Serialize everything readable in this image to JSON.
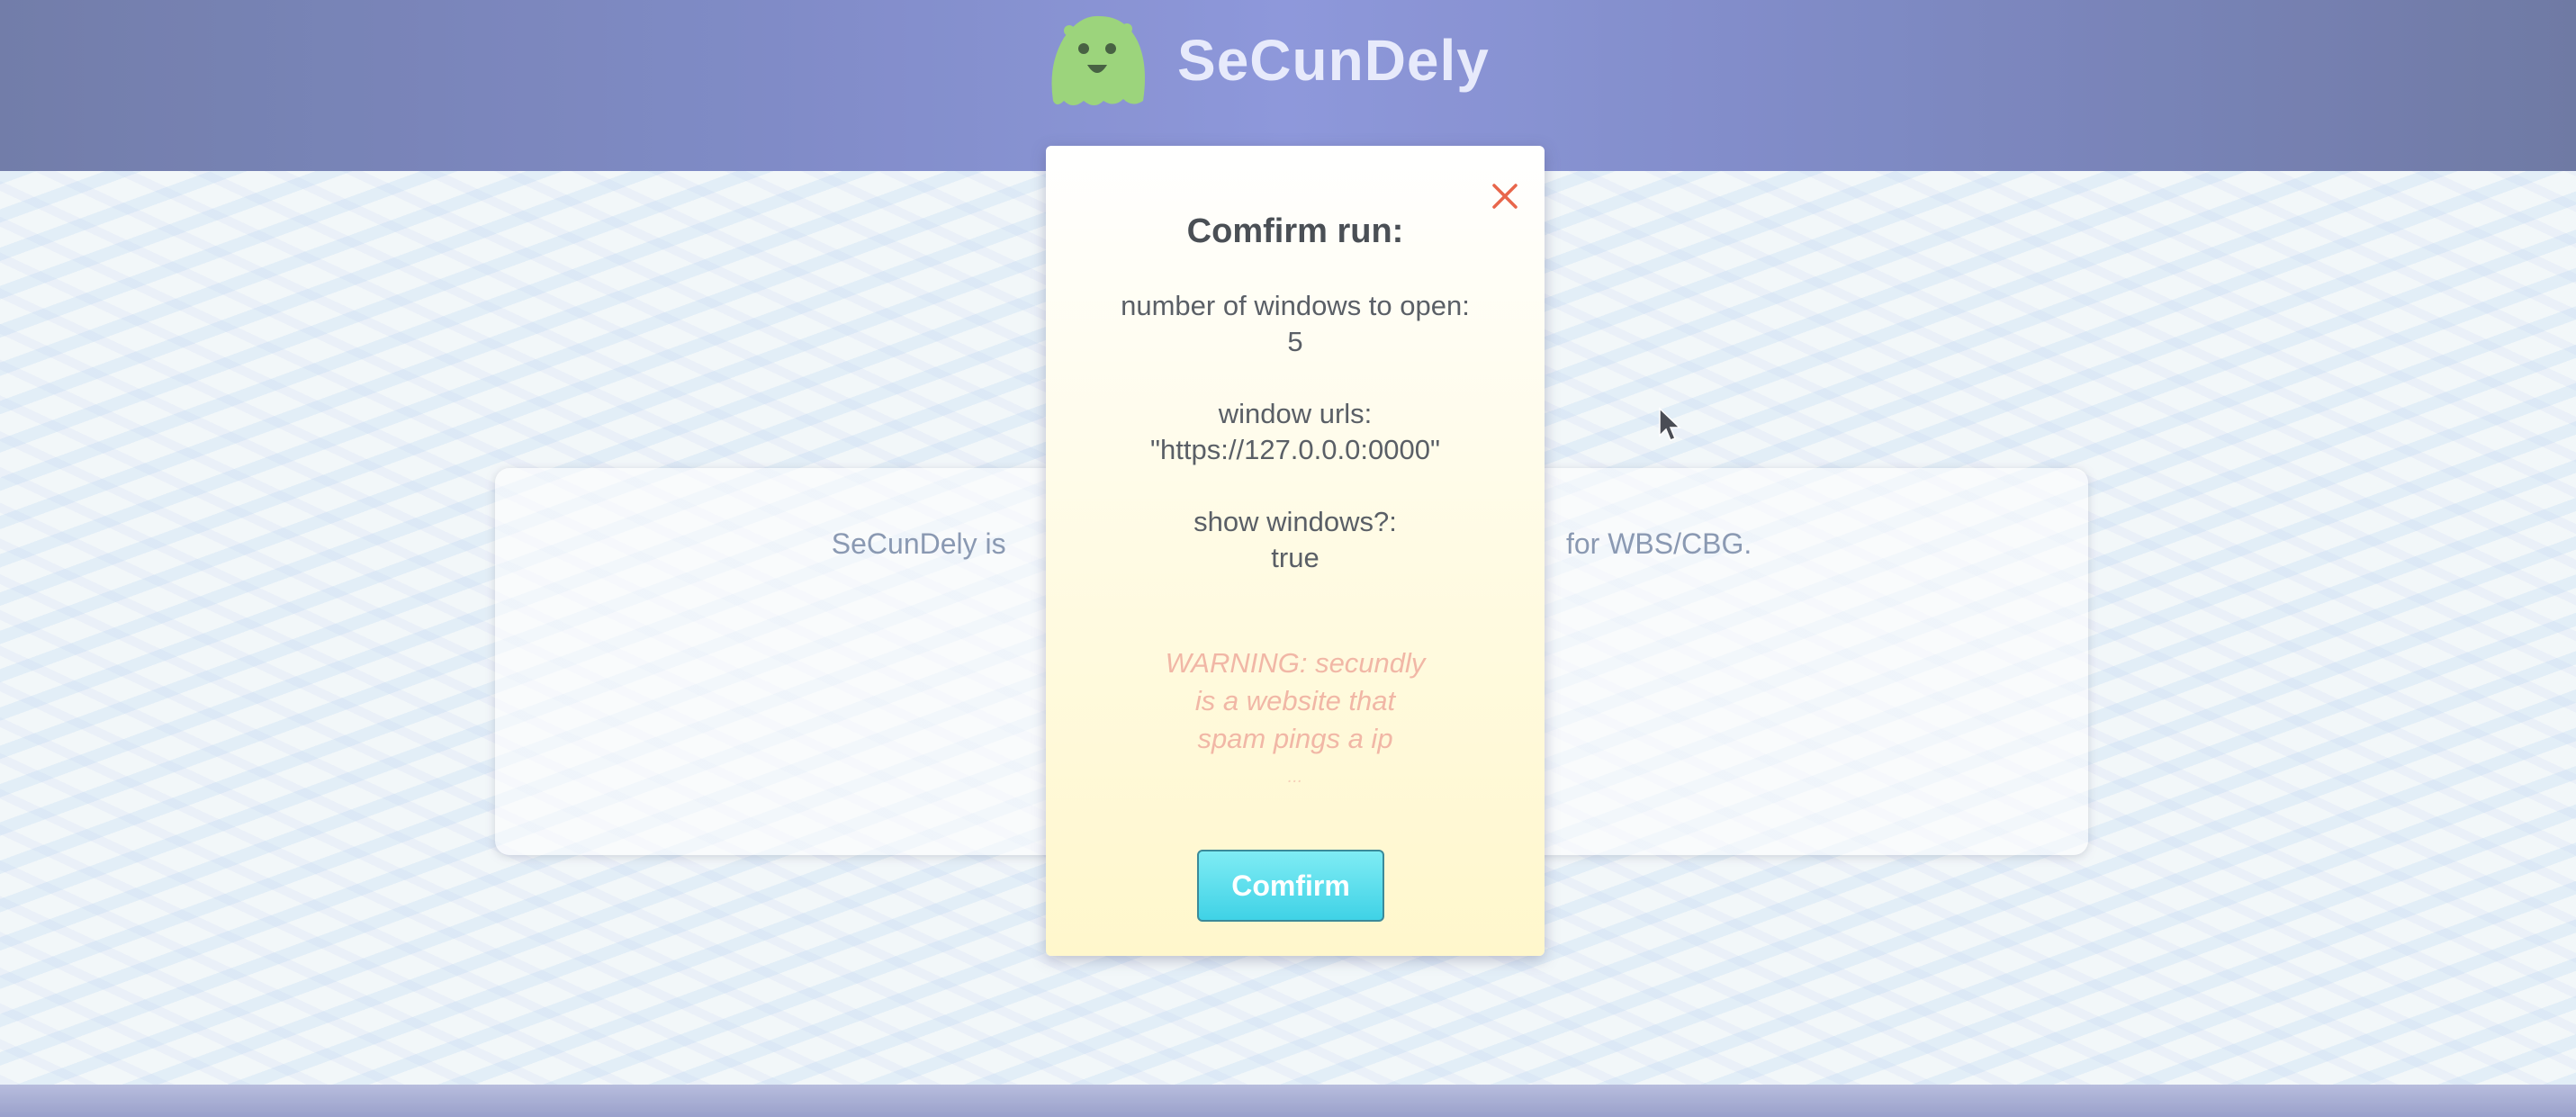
{
  "header": {
    "brand": "SeCunDely",
    "logo_icon": "ghost-mascot-icon"
  },
  "card": {
    "text": "SeCunDely is                                                                      for WBS/CBG."
  },
  "modal": {
    "title": "Comfirm run:",
    "close_icon": "close-icon",
    "fields": [
      {
        "label": "number of windows to open:",
        "value": "5"
      },
      {
        "label": "window urls:",
        "value": "\"https://127.0.0.0:0000\""
      },
      {
        "label": "show windows?:",
        "value": "true"
      }
    ],
    "warning_lines": [
      "WARNING: secundly",
      "is a website that",
      "spam pings a ip",
      "..."
    ],
    "confirm_label": "Comfirm"
  },
  "colors": {
    "header": "#6f7cc0",
    "brand_text": "#e4e8fb",
    "warning": "#f1b7a6",
    "confirm_button": "#3fd2e6",
    "close_icon": "#e8664b"
  }
}
